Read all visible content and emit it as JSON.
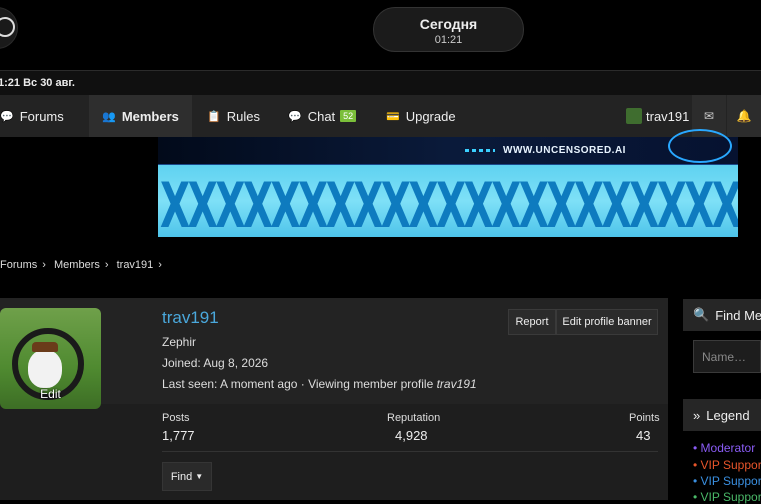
{
  "overlay": {
    "title": "Сегодня",
    "time": "01:21"
  },
  "statusbar": {
    "text": "1:21   Вс 30 авг."
  },
  "nav": {
    "items": [
      {
        "label": "Forums",
        "icon": "comments-icon"
      },
      {
        "label": "Members",
        "icon": "users-icon"
      },
      {
        "label": "Rules",
        "icon": "rules-icon"
      },
      {
        "label": "Chat",
        "icon": "chat-icon",
        "badge": "52"
      },
      {
        "label": "Upgrade",
        "icon": "card-icon"
      }
    ],
    "user": "trav191",
    "icons": [
      "mail-icon",
      "bell-icon"
    ]
  },
  "banner": {
    "url": "WWW.UNCENSORED.AI",
    "text": "XXXXXXXXXXXXXXXXXXXXXX"
  },
  "breadcrumb": [
    "Forums",
    "Members",
    "trav191"
  ],
  "profile": {
    "username": "trav191",
    "title": "Zephir",
    "joined": "Joined: Aug 8, 2026",
    "last_seen_prefix": "Last seen: A moment ago · Viewing member profile ",
    "last_seen_user": "trav191",
    "avatar_edit": "Edit",
    "report_label": "Report",
    "edit_banner_label": "Edit profile banner",
    "stats": [
      {
        "label": "Posts",
        "value": "1,777"
      },
      {
        "label": "Reputation",
        "value": "4,928"
      },
      {
        "label": "Points",
        "value": "43"
      }
    ],
    "find_label": "Find"
  },
  "sidebar": {
    "find_members": "Find Members",
    "name_placeholder": "Name…",
    "legend_title": "Legend",
    "legend": [
      {
        "label": "• Moderator",
        "color": "#8a5cf5"
      },
      {
        "label": "• VIP Supporter",
        "color": "#e8552a"
      },
      {
        "label": "• VIP Supporter",
        "color": "#3a8fe0"
      },
      {
        "label": "• VIP Supporter",
        "color": "#4ab868"
      }
    ]
  }
}
